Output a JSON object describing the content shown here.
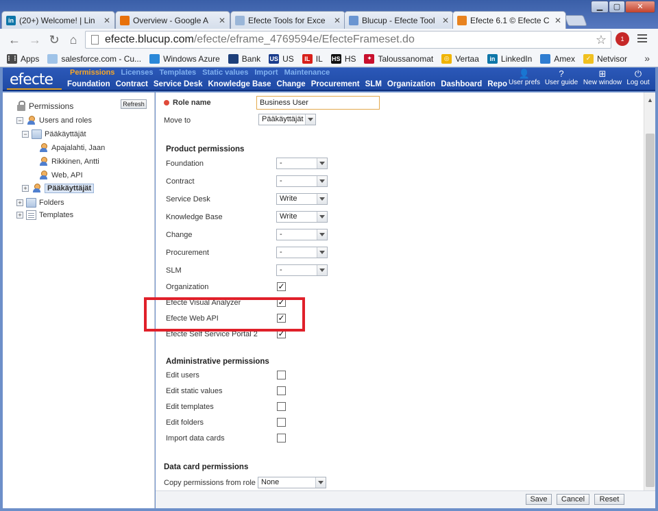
{
  "browser": {
    "tabs": [
      {
        "title": "(20+) Welcome! | Lin",
        "icon": "linkedin-icon",
        "color": "#0e76a8",
        "glyph": "in"
      },
      {
        "title": "Overview - Google A",
        "icon": "analytics-icon",
        "color": "#e8710a",
        "glyph": ""
      },
      {
        "title": "Efecte Tools for Exce",
        "icon": "cloud-icon",
        "color": "#9ab6d8",
        "glyph": ""
      },
      {
        "title": "Blucup - Efecte Tool",
        "icon": "blucup-icon",
        "color": "#6a95d1",
        "glyph": ""
      },
      {
        "title": "Efecte 6.1 © Efecte C",
        "icon": "efecte-icon",
        "color": "#e8831f",
        "glyph": ""
      }
    ],
    "close_glyph": "✕",
    "url_host": "efecte.blucup.com",
    "url_path": "/efecte/eframe_4769594e/EfecteFrameset.do",
    "ext_badge": "1",
    "bookmarks": [
      {
        "label": "Apps",
        "icon": "apps-icon",
        "color": "#4a4a4a",
        "glyph": "⋮⋮"
      },
      {
        "label": "salesforce.com - Cu...",
        "icon": "salesforce-icon",
        "color": "#9fc3e8",
        "glyph": ""
      },
      {
        "label": "Windows Azure",
        "icon": "windows-icon",
        "color": "#2b88d8",
        "glyph": ""
      },
      {
        "label": "Bank",
        "icon": "bank-icon",
        "color": "#1d3f7a",
        "glyph": ""
      },
      {
        "label": "US",
        "icon": "us-icon",
        "color": "#1a3c8c",
        "glyph": "US"
      },
      {
        "label": "IL",
        "icon": "il-icon",
        "color": "#d8201a",
        "glyph": "IL"
      },
      {
        "label": "HS",
        "icon": "hs-icon",
        "color": "#111111",
        "glyph": "HS"
      },
      {
        "label": "Taloussanomat",
        "icon": "taloussanomat-icon",
        "color": "#c8102e",
        "glyph": "✦"
      },
      {
        "label": "Vertaa",
        "icon": "vertaa-icon",
        "color": "#f0b400",
        "glyph": "◎"
      },
      {
        "label": "LinkedIn",
        "icon": "linkedin-icon",
        "color": "#0e76a8",
        "glyph": "in"
      },
      {
        "label": "Amex",
        "icon": "amex-icon",
        "color": "#2f7dd1",
        "glyph": ""
      },
      {
        "label": "Netvisor",
        "icon": "netvisor-icon",
        "color": "#f0c020",
        "glyph": "✓"
      }
    ],
    "bookmarks_more": "»"
  },
  "app": {
    "logo": "efecte",
    "subnav": [
      "Permissions",
      "Licenses",
      "Templates",
      "Static values",
      "Import",
      "Maintenance"
    ],
    "mainnav": [
      "Foundation",
      "Contract",
      "Service Desk",
      "Knowledge Base",
      "Change",
      "Procurement",
      "SLM",
      "Organization",
      "Dashboard",
      "Reports"
    ],
    "tools": [
      {
        "label": "User prefs",
        "icon": "user-prefs-icon",
        "glyph": "👤"
      },
      {
        "label": "User guide",
        "icon": "help-icon",
        "glyph": "?"
      },
      {
        "label": "New window",
        "icon": "new-window-icon",
        "glyph": "⊞"
      },
      {
        "label": "Log out",
        "icon": "power-icon",
        "glyph": "⏻"
      }
    ]
  },
  "tree": {
    "root": "Permissions",
    "refresh": "Refresh",
    "items": [
      {
        "label": "Users and roles",
        "level": 0,
        "expander": "−",
        "icon": "user"
      },
      {
        "label": "Pääkäyttäjät",
        "level": 1,
        "expander": "−",
        "icon": "folder"
      },
      {
        "label": "Apajalahti, Jaan",
        "level": 2,
        "expander": "",
        "icon": "user"
      },
      {
        "label": "Rikkinen, Antti",
        "level": 2,
        "expander": "",
        "icon": "user"
      },
      {
        "label": "Web, API",
        "level": 2,
        "expander": "",
        "icon": "user"
      },
      {
        "label": "Pääkäyttäjät",
        "level": 1,
        "expander": "+",
        "icon": "user",
        "selected": true
      },
      {
        "label": "Folders",
        "level": 0,
        "expander": "+",
        "icon": "folder"
      },
      {
        "label": "Templates",
        "level": 0,
        "expander": "+",
        "icon": "template"
      }
    ]
  },
  "form": {
    "role_name_label": "Role name",
    "role_name_value": "Business User",
    "move_to_label": "Move to",
    "move_to_value": "Pääkäyttäjät",
    "product_section": "Product permissions",
    "product_permissions": [
      {
        "label": "Foundation",
        "type": "select",
        "value": "-"
      },
      {
        "label": "Contract",
        "type": "select",
        "value": "-"
      },
      {
        "label": "Service Desk",
        "type": "select",
        "value": "Write"
      },
      {
        "label": "Knowledge Base",
        "type": "select",
        "value": "Write"
      },
      {
        "label": "Change",
        "type": "select",
        "value": "-"
      },
      {
        "label": "Procurement",
        "type": "select",
        "value": "-"
      },
      {
        "label": "SLM",
        "type": "select",
        "value": "-"
      },
      {
        "label": "Organization",
        "type": "check",
        "checked": true
      },
      {
        "label": "Efecte Visual Analyzer",
        "type": "check",
        "checked": true
      },
      {
        "label": "Efecte Web API",
        "type": "check",
        "checked": true
      },
      {
        "label": "Efecte Self Service Portal 2",
        "type": "check",
        "checked": true
      }
    ],
    "admin_section": "Administrative permissions",
    "admin_permissions": [
      {
        "label": "Edit users",
        "checked": false
      },
      {
        "label": "Edit static values",
        "checked": false
      },
      {
        "label": "Edit templates",
        "checked": false
      },
      {
        "label": "Edit folders",
        "checked": false
      },
      {
        "label": "Import data cards",
        "checked": false
      }
    ],
    "datacard_section": "Data card permissions",
    "copy_label": "Copy permissions from role",
    "copy_value": "None",
    "check_glyph": "✓"
  },
  "footer": {
    "save": "Save",
    "cancel": "Cancel",
    "reset": "Reset"
  },
  "colors": {
    "highlight": "#e0202a",
    "header_blue": "#2b58b8",
    "subnav_active": "#f7a726"
  }
}
